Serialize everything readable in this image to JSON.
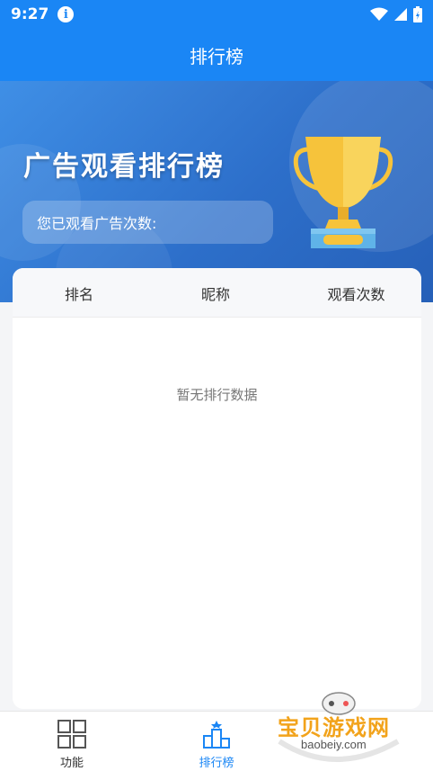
{
  "status_bar": {
    "time": "9:27",
    "info_glyph": "i"
  },
  "app_bar": {
    "title": "排行榜"
  },
  "banner": {
    "title": "广告观看排行榜",
    "watch_count_label": "您已观看广告次数:"
  },
  "table": {
    "headers": {
      "rank": "排名",
      "nickname": "昵称",
      "count": "观看次数"
    },
    "empty_message": "暂无排行数据"
  },
  "bottom_nav": {
    "items": [
      {
        "label": "功能",
        "icon": "grid-icon",
        "active": false
      },
      {
        "label": "排行榜",
        "icon": "podium-icon",
        "active": true
      }
    ]
  },
  "watermark": {
    "text": "宝贝游戏网",
    "url": "baobeiy.com"
  },
  "colors": {
    "primary": "#1a86f5",
    "banner_dark": "#2660b8",
    "trophy_gold": "#f6c33b"
  }
}
